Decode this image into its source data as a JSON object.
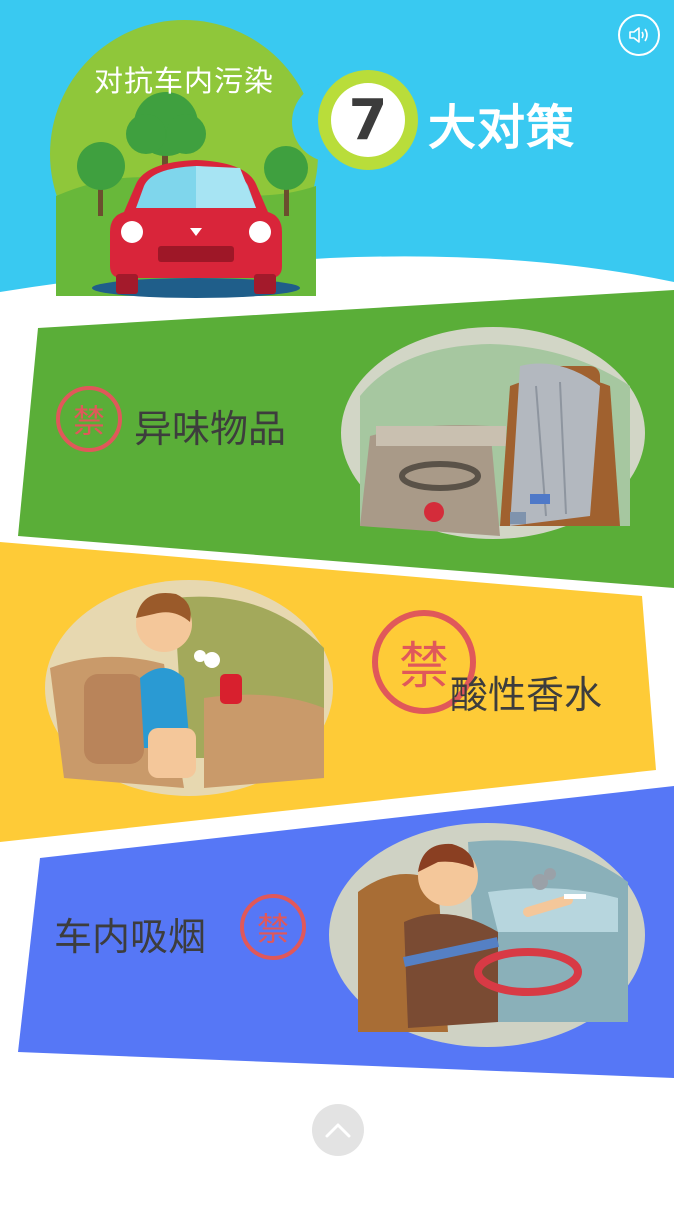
{
  "header": {
    "subtitle": "对抗车内污染",
    "number": "7",
    "title": "大对策",
    "sound_icon": "speaker-icon"
  },
  "banner_badge": "禁",
  "sections": [
    {
      "label": "异味物品",
      "color": "#5aae38"
    },
    {
      "label": "酸性香水",
      "color": "#fecb37"
    },
    {
      "label": "车内吸烟",
      "color": "#5677f6"
    }
  ],
  "colors": {
    "sky": "#39c9f1",
    "hill": "#8fc73a",
    "badge_red": "#e0585a"
  },
  "footer": {
    "scroll_up_icon": "chevron-up-icon"
  }
}
